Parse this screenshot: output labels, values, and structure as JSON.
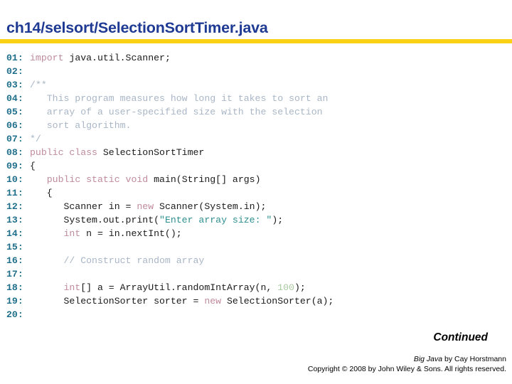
{
  "slide": {
    "title": "ch14/selsort/SelectionSortTimer.java",
    "accent_color": "#FBD116",
    "title_color": "#1F3A93",
    "continued_label": "Continued",
    "footer": {
      "book_title": "Big Java",
      "byline": " by Cay Horstmann",
      "copyright": "Copyright © 2008 by John Wiley & Sons.  All rights reserved."
    }
  },
  "code": {
    "syntax_colors": {
      "line_number": "#1F6F8B",
      "keyword": "#C08B9C",
      "string": "#2E8F8F",
      "comment": "#A9B6C6",
      "number": "#A9C9A0",
      "plain": "#1a1a1a"
    },
    "lines": [
      {
        "number": "01:",
        "tokens": [
          {
            "t": "kw",
            "s": "import "
          },
          {
            "t": "plain",
            "s": "java.util.Scanner;"
          }
        ]
      },
      {
        "number": "02:",
        "tokens": []
      },
      {
        "number": "03:",
        "tokens": [
          {
            "t": "com",
            "s": "/**"
          }
        ]
      },
      {
        "number": "04:",
        "tokens": [
          {
            "t": "com",
            "s": "   This program measures how long it takes to sort an"
          }
        ]
      },
      {
        "number": "05:",
        "tokens": [
          {
            "t": "com",
            "s": "   array of a user-specified size with the selection"
          }
        ]
      },
      {
        "number": "06:",
        "tokens": [
          {
            "t": "com",
            "s": "   sort algorithm."
          }
        ]
      },
      {
        "number": "07:",
        "tokens": [
          {
            "t": "com",
            "s": "*/"
          }
        ]
      },
      {
        "number": "08:",
        "tokens": [
          {
            "t": "kw",
            "s": "public class "
          },
          {
            "t": "plain",
            "s": "SelectionSortTimer"
          }
        ]
      },
      {
        "number": "09:",
        "tokens": [
          {
            "t": "plain",
            "s": "{"
          }
        ]
      },
      {
        "number": "10:",
        "tokens": [
          {
            "t": "plain",
            "s": "   "
          },
          {
            "t": "kw",
            "s": "public static void "
          },
          {
            "t": "plain",
            "s": "main(String[] args)"
          }
        ]
      },
      {
        "number": "11:",
        "tokens": [
          {
            "t": "plain",
            "s": "   {"
          }
        ]
      },
      {
        "number": "12:",
        "tokens": [
          {
            "t": "plain",
            "s": "      Scanner in = "
          },
          {
            "t": "kw",
            "s": "new "
          },
          {
            "t": "plain",
            "s": "Scanner(System.in);"
          }
        ]
      },
      {
        "number": "13:",
        "tokens": [
          {
            "t": "plain",
            "s": "      System.out.print("
          },
          {
            "t": "str",
            "s": "\"Enter array size: \""
          },
          {
            "t": "plain",
            "s": ");"
          }
        ]
      },
      {
        "number": "14:",
        "tokens": [
          {
            "t": "plain",
            "s": "      "
          },
          {
            "t": "kw",
            "s": "int "
          },
          {
            "t": "plain",
            "s": "n = in.nextInt();"
          }
        ]
      },
      {
        "number": "15:",
        "tokens": []
      },
      {
        "number": "16:",
        "tokens": [
          {
            "t": "plain",
            "s": "      "
          },
          {
            "t": "com",
            "s": "// Construct random array"
          }
        ]
      },
      {
        "number": "17:",
        "tokens": []
      },
      {
        "number": "18:",
        "tokens": [
          {
            "t": "plain",
            "s": "      "
          },
          {
            "t": "kw",
            "s": "int"
          },
          {
            "t": "plain",
            "s": "[] a = ArrayUtil.randomIntArray(n, "
          },
          {
            "t": "num",
            "s": "100"
          },
          {
            "t": "plain",
            "s": ");"
          }
        ]
      },
      {
        "number": "19:",
        "tokens": [
          {
            "t": "plain",
            "s": "      SelectionSorter sorter = "
          },
          {
            "t": "kw",
            "s": "new "
          },
          {
            "t": "plain",
            "s": "SelectionSorter(a);"
          }
        ]
      },
      {
        "number": "20:",
        "tokens": []
      }
    ]
  }
}
